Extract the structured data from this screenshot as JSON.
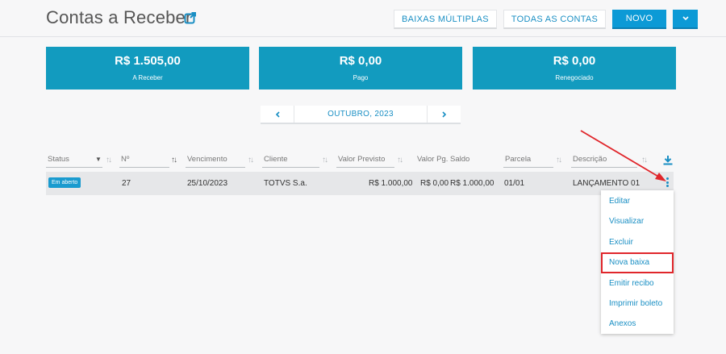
{
  "header": {
    "title": "Contas a Receber",
    "buttons": {
      "baixas_multiplas": "BAIXAS MÚLTIPLAS",
      "todas_as_contas": "TODAS AS CONTAS",
      "novo": "NOVO"
    }
  },
  "summary_cards": [
    {
      "amount": "R$ 1.505,00",
      "label": "A Receber"
    },
    {
      "amount": "R$ 0,00",
      "label": "Pago"
    },
    {
      "amount": "R$ 0,00",
      "label": "Renegociado"
    }
  ],
  "month_nav": {
    "prev_icon": "chevron-left-icon",
    "label": "OUTUBRO, 2023",
    "next_icon": "chevron-right-icon"
  },
  "table": {
    "columns": [
      "Status",
      "Nº",
      "Vencimento",
      "Cliente",
      "Valor Previsto",
      "Valor Pg.",
      "Saldo",
      "Parcela",
      "Descrição"
    ],
    "rows": [
      {
        "status": "Em aberto",
        "numero": "27",
        "vencimento": "25/10/2023",
        "cliente": "TOTVS S.a.",
        "valor_previsto": "R$ 1.000,00",
        "valor_pago": "R$ 0,00",
        "saldo": "R$ 1.000,00",
        "parcela": "01/01",
        "descricao": "LANÇAMENTO 01"
      }
    ]
  },
  "row_menu": {
    "items": [
      "Editar",
      "Visualizar",
      "Excluir",
      "Nova baixa",
      "Emitir recibo",
      "Imprimir boleto",
      "Anexos"
    ],
    "highlighted": "Nova baixa"
  },
  "colors": {
    "primary": "#0c9ad6",
    "card": "#129bbf",
    "link": "#1a8fc4",
    "annotation": "#e0262b"
  }
}
